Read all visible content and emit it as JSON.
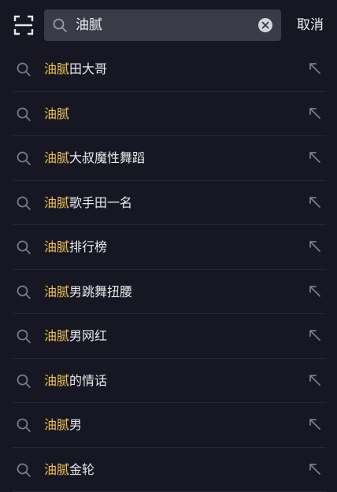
{
  "search": {
    "value": "油腻",
    "cancel_label": "取消"
  },
  "suggestions": [
    {
      "highlight": "油腻",
      "rest": "田大哥"
    },
    {
      "highlight": "油腻",
      "rest": ""
    },
    {
      "highlight": "油腻",
      "rest": "大叔魔性舞蹈"
    },
    {
      "highlight": "油腻",
      "rest": "歌手田一名"
    },
    {
      "highlight": "油腻",
      "rest": "排行榜"
    },
    {
      "highlight": "油腻",
      "rest": "男跳舞扭腰"
    },
    {
      "highlight": "油腻",
      "rest": "男网红"
    },
    {
      "highlight": "油腻",
      "rest": "的情话"
    },
    {
      "highlight": "油腻",
      "rest": "男"
    },
    {
      "highlight": "油腻",
      "rest": "金轮"
    }
  ],
  "colors": {
    "background": "#161722",
    "search_field": "#3a3b47",
    "highlight": "#f2c24f"
  },
  "icons": {
    "scan": "scan-icon",
    "search": "search-icon",
    "clear": "clear-icon",
    "fill": "arrow-up-left-icon"
  }
}
